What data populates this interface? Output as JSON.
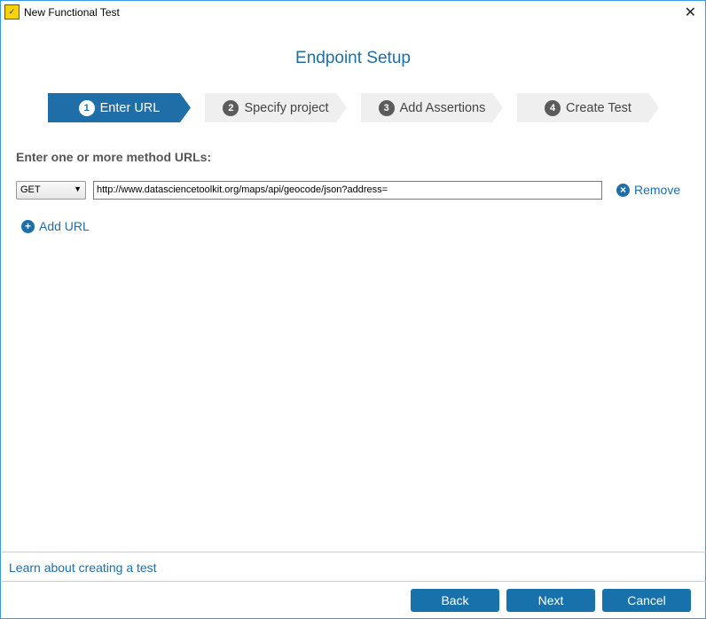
{
  "window": {
    "title": "New Functional Test",
    "close_label": "✕"
  },
  "heading": "Endpoint Setup",
  "steps": [
    {
      "num": "1",
      "label": "Enter URL"
    },
    {
      "num": "2",
      "label": "Specify project"
    },
    {
      "num": "3",
      "label": "Add Assertions"
    },
    {
      "num": "4",
      "label": "Create Test"
    }
  ],
  "form": {
    "label": "Enter one or more method URLs:",
    "method": "GET",
    "url": "http://www.datasciencetoolkit.org/maps/api/geocode/json?address=",
    "remove_label": "Remove",
    "add_url_label": "Add URL"
  },
  "footer": {
    "learn_link": "Learn about creating a test",
    "back": "Back",
    "next": "Next",
    "cancel": "Cancel"
  },
  "colors": {
    "accent": "#1f6ea8",
    "button": "#1771aa",
    "border": "#3c9be6"
  }
}
